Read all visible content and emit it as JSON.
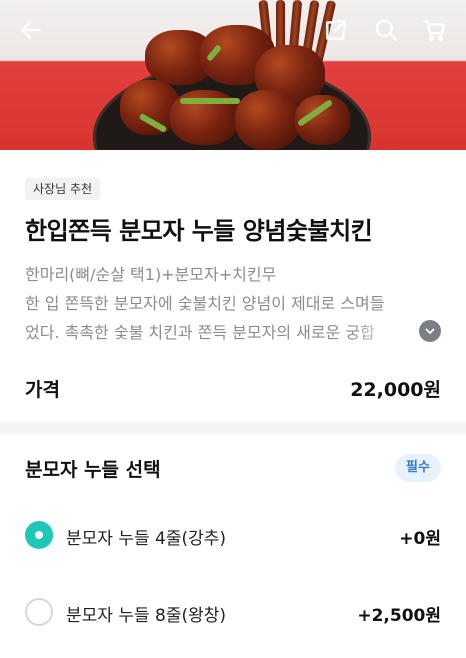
{
  "header": {
    "back_icon": "back-arrow-icon",
    "share_icon": "share-external-icon",
    "search_icon": "search-icon",
    "cart_icon": "cart-icon"
  },
  "product": {
    "badge": "사장님 추천",
    "title": "한입쫀득 분모자 누들 양념숯불치킨",
    "description_lines": [
      "한마리(뼈/순살 택1)+분모자+치킨무",
      "한 입 쫀뜩한 분모자에 숯불치킨 양념이 제대로 스며들",
      "었다. 촉촉한 숯불 치킨과 쫀득 분모자의 새로운 궁합"
    ],
    "price_label": "가격",
    "price_value": "22,000원"
  },
  "option_group": {
    "title": "분모자 누들 선택",
    "required_badge": "필수",
    "options": [
      {
        "label": "분모자 누들 4줄(강추)",
        "price": "+0원",
        "selected": true
      },
      {
        "label": "분모자 누들 8줄(왕창)",
        "price": "+2,500원",
        "selected": false
      }
    ]
  },
  "colors": {
    "accent": "#1fc7b6",
    "required_text": "#2f7cd6",
    "required_bg": "#e8f2fd",
    "hero_background": "#d8332f"
  }
}
